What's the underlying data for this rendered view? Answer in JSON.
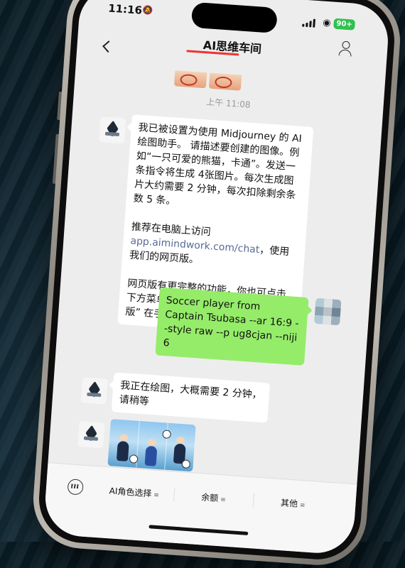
{
  "status_bar": {
    "time": "11:16",
    "battery": "90+"
  },
  "header": {
    "title": "AI思维车间"
  },
  "chat": {
    "timestamp": "上午 11:08",
    "bot_intro": {
      "p1": "我已被设置为使用 Midjourney 的 AI绘图助手。 请描述要创建的图像。例如“一只可爱的熊猫，卡通”。发送一条指令将生成 4张图片。每次生成图片大约需要 2 分钟，每次扣除剩余条数 5 条。",
      "p2_prefix": "推荐在电脑上访问",
      "p2_link": "app.aimindwork.com/chat",
      "p2_suffix": "，使用我们的网页版。",
      "p3": "网页版有更完整的功能，你也可点击下方菜单 “其他”-“AI 思维车间网页版” 在手机上使用网页版。"
    },
    "user_prompt": "Soccer player from Captain Tsubasa --ar 16:9 --style raw --p ug8cjan --niji 6",
    "bot_wait": "我正在绘图，大概需要 2 分钟，请稍等"
  },
  "menu": {
    "items": [
      {
        "label": "AI角色选择"
      },
      {
        "label": "余额"
      },
      {
        "label": "其他"
      }
    ]
  },
  "icons": {
    "back": "chevron-left-icon",
    "profile": "person-icon",
    "keyboard": "keyboard-icon",
    "wifi": "wifi-icon",
    "mute": "bell-slash-icon"
  },
  "colors": {
    "user_bubble": "#95ec69",
    "chat_bg": "#ededed",
    "link": "#576b95",
    "battery": "#31c14f",
    "title_underline": "#e33333"
  }
}
